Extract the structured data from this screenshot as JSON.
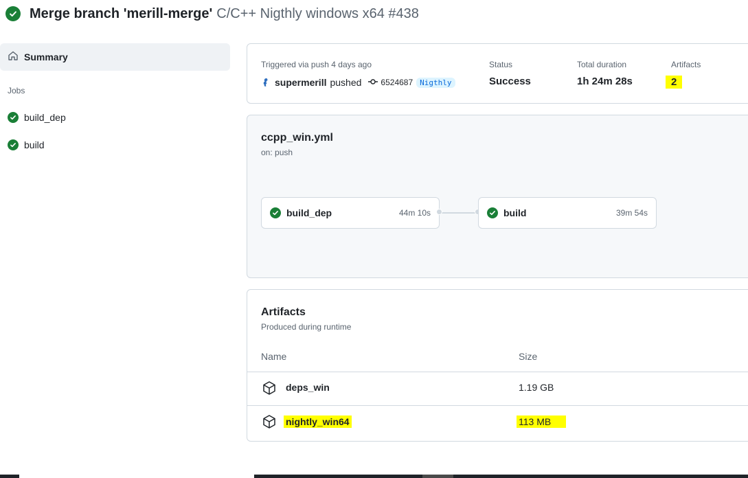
{
  "header": {
    "title": "Merge branch 'merill-merge'",
    "subtitle": "C/C++ Nigthly windows x64 #438",
    "status_icon": "check-circle-icon"
  },
  "sidebar": {
    "summary_label": "Summary",
    "jobs_heading": "Jobs",
    "jobs": [
      {
        "label": "build_dep"
      },
      {
        "label": "build"
      }
    ]
  },
  "summary": {
    "trigger_text": "Triggered via push 4 days ago",
    "user": "supermerill",
    "action": "pushed",
    "commit_sha": "6524687",
    "branch": "Nigthly",
    "status_label": "Status",
    "status_value": "Success",
    "duration_label": "Total duration",
    "duration_value": "1h 24m 28s",
    "artifacts_label": "Artifacts",
    "artifacts_value": "2"
  },
  "workflow": {
    "file": "ccpp_win.yml",
    "trigger": "on: push",
    "jobs": [
      {
        "name": "build_dep",
        "duration": "44m 10s"
      },
      {
        "name": "build",
        "duration": "39m 54s"
      }
    ]
  },
  "artifacts": {
    "title": "Artifacts",
    "subtitle": "Produced during runtime",
    "col_name": "Name",
    "col_size": "Size",
    "rows": [
      {
        "name": "deps_win",
        "size": "1.19 GB"
      },
      {
        "name": "nightly_win64",
        "size": "113 MB"
      }
    ]
  },
  "colors": {
    "success": "#1a7f37",
    "highlight": "#ffff00",
    "link": "#0969da"
  }
}
